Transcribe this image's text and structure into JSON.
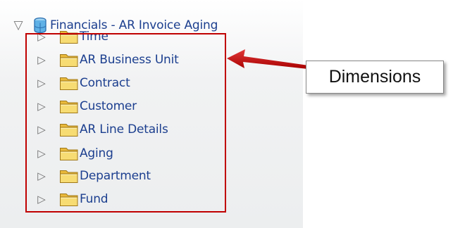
{
  "tree": {
    "root": {
      "label": "Financials - AR Invoice Aging",
      "expander": "▽",
      "icon": "cube-database-icon"
    },
    "items": [
      {
        "label": "Time",
        "expander": "▷",
        "icon": "folder-icon"
      },
      {
        "label": "AR Business Unit",
        "expander": "▷",
        "icon": "folder-icon"
      },
      {
        "label": "Contract",
        "expander": "▷",
        "icon": "folder-icon"
      },
      {
        "label": "Customer",
        "expander": "▷",
        "icon": "folder-icon"
      },
      {
        "label": "AR Line Details",
        "expander": "▷",
        "icon": "folder-icon"
      },
      {
        "label": "Aging",
        "expander": "▷",
        "icon": "folder-icon"
      },
      {
        "label": "Department",
        "expander": "▷",
        "icon": "folder-icon"
      },
      {
        "label": "Fund",
        "expander": "▷",
        "icon": "folder-icon"
      }
    ]
  },
  "callout": {
    "label": "Dimensions"
  },
  "colors": {
    "label_text": "#1c3f8f",
    "highlight_border": "#c00000",
    "arrow": "#c00000",
    "folder_fill": "#f4d66a"
  }
}
